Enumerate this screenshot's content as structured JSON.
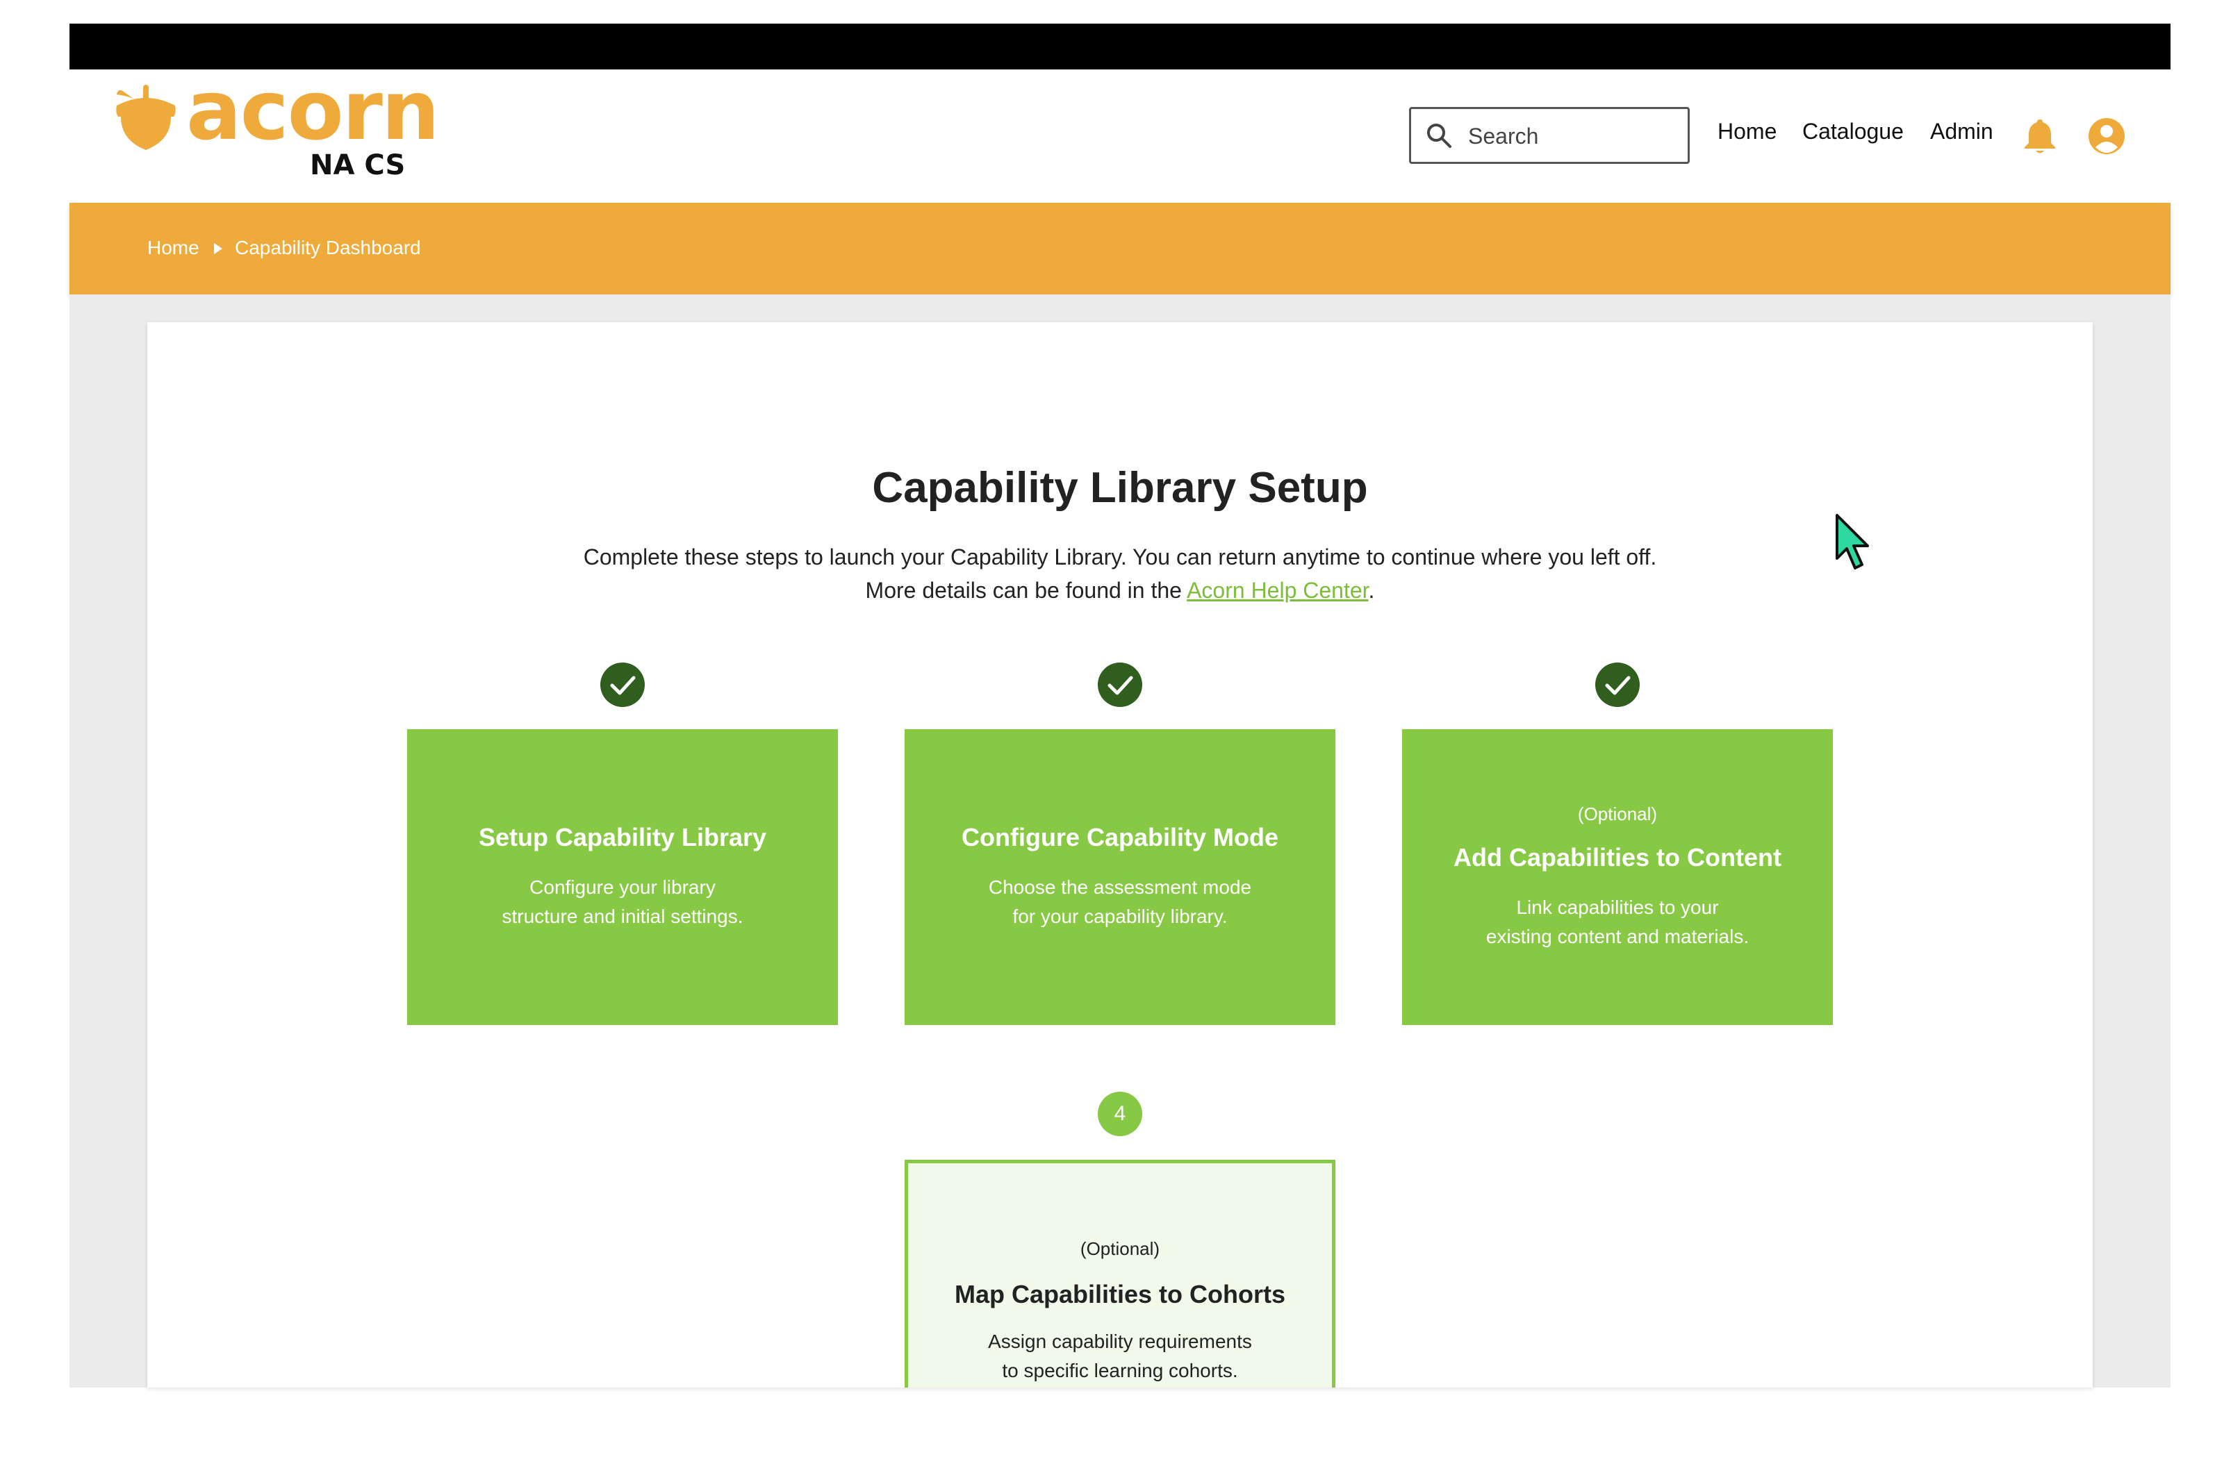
{
  "brand": {
    "name": "acorn",
    "subtitle": "NA CS",
    "color": "#eeaa3b"
  },
  "header": {
    "search_placeholder": "Search",
    "nav": [
      "Home",
      "Catalogue",
      "Admin"
    ],
    "icons": [
      "search-icon",
      "bell-icon",
      "user-avatar-icon"
    ]
  },
  "breadcrumb": {
    "items": [
      "Home",
      "Capability Dashboard"
    ]
  },
  "main": {
    "title": "Capability Library Setup",
    "intro_line1": "Complete these steps to launch your Capability Library. You can return anytime to continue where you left off.",
    "intro_line2_prefix": "More details can be found in the ",
    "help_link": "Acorn Help Center",
    "intro_line2_suffix": "."
  },
  "steps": [
    {
      "status": "complete",
      "optional_label": "",
      "title": "Setup Capability Library",
      "description": "Configure your library\nstructure and initial settings."
    },
    {
      "status": "complete",
      "optional_label": "",
      "title": "Configure Capability Mode",
      "description": "Choose the assessment mode\nfor your capability library."
    },
    {
      "status": "complete",
      "optional_label": "(Optional)",
      "title": "Add Capabilities to Content",
      "description": "Link capabilities to your\nexisting content and materials."
    },
    {
      "status": "current",
      "number": "4",
      "optional_label": "(Optional)",
      "title": "Map Capabilities to Cohorts",
      "description": "Assign capability requirements\nto specific learning cohorts."
    }
  ],
  "colors": {
    "step_complete": "#87c944",
    "check_badge": "#2f5e1e",
    "step_current_bg": "#f1f9ea",
    "breadcrumb_bar": "#eeaa3b",
    "link": "#7cbe3a"
  }
}
